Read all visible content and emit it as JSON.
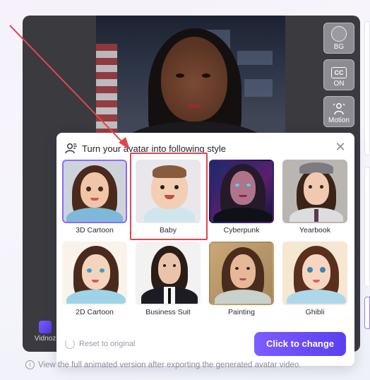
{
  "preview": {
    "tools": [
      {
        "label": "BG",
        "icon": "circle-icon"
      },
      {
        "label": "ON",
        "icon": "cc-icon",
        "icon_text": "CC"
      },
      {
        "label": "Motion",
        "icon": "person-motion-icon"
      }
    ],
    "brand": "Vidnoz"
  },
  "modal": {
    "title": "Turn your avatar into following style",
    "styles": [
      {
        "label": "3D Cartoon",
        "selected": true
      },
      {
        "label": "Baby",
        "selected": false
      },
      {
        "label": "Cyberpunk",
        "selected": false
      },
      {
        "label": "Yearbook",
        "selected": false
      },
      {
        "label": "2D Cartoon",
        "selected": false
      },
      {
        "label": "Business Suit",
        "selected": false
      },
      {
        "label": "Painting",
        "selected": false
      },
      {
        "label": "Ghibli",
        "selected": false
      }
    ],
    "reset_label": "Reset to original",
    "primary_button": "Click to change"
  },
  "footer": {
    "note": "View the full animated version after exporting the generated avatar video."
  },
  "colors": {
    "accent": "#6b4cf5",
    "annotation": "#e0474c"
  }
}
